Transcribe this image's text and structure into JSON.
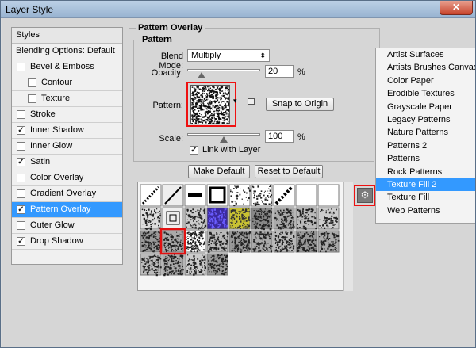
{
  "window": {
    "title": "Layer Style",
    "close_glyph": "✕"
  },
  "styles_panel": {
    "header": "Styles",
    "items": [
      {
        "label": "Blending Options: Default",
        "has_checkbox": false,
        "checked": false,
        "indent": false,
        "selected": false
      },
      {
        "label": "Bevel & Emboss",
        "has_checkbox": true,
        "checked": false,
        "indent": false,
        "selected": false
      },
      {
        "label": "Contour",
        "has_checkbox": true,
        "checked": false,
        "indent": true,
        "selected": false
      },
      {
        "label": "Texture",
        "has_checkbox": true,
        "checked": false,
        "indent": true,
        "selected": false
      },
      {
        "label": "Stroke",
        "has_checkbox": true,
        "checked": false,
        "indent": false,
        "selected": false
      },
      {
        "label": "Inner Shadow",
        "has_checkbox": true,
        "checked": true,
        "indent": false,
        "selected": false
      },
      {
        "label": "Inner Glow",
        "has_checkbox": true,
        "checked": false,
        "indent": false,
        "selected": false
      },
      {
        "label": "Satin",
        "has_checkbox": true,
        "checked": true,
        "indent": false,
        "selected": false
      },
      {
        "label": "Color Overlay",
        "has_checkbox": true,
        "checked": false,
        "indent": false,
        "selected": false
      },
      {
        "label": "Gradient Overlay",
        "has_checkbox": true,
        "checked": false,
        "indent": false,
        "selected": false
      },
      {
        "label": "Pattern Overlay",
        "has_checkbox": true,
        "checked": true,
        "indent": false,
        "selected": true
      },
      {
        "label": "Outer Glow",
        "has_checkbox": true,
        "checked": false,
        "indent": false,
        "selected": false
      },
      {
        "label": "Drop Shadow",
        "has_checkbox": true,
        "checked": true,
        "indent": false,
        "selected": false
      }
    ]
  },
  "pattern_overlay": {
    "group_title": "Pattern Overlay",
    "subgroup_title": "Pattern",
    "blend_mode_label": "Blend Mode:",
    "blend_mode_value": "Multiply",
    "opacity_label": "Opacity:",
    "opacity_value": "20",
    "opacity_fraction": 0.2,
    "percent_unit": "%",
    "pattern_label": "Pattern:",
    "snap_button": "Snap to Origin",
    "scale_label": "Scale:",
    "scale_value": "100",
    "scale_fraction": 0.5,
    "link_label": "Link with Layer",
    "link_checked": true,
    "make_default_button": "Make Default",
    "reset_default_button": "Reset to Default"
  },
  "pattern_picker": {
    "gear_glyph": "⚙",
    "selected_index": 19
  },
  "flyout_menu": {
    "items": [
      {
        "label": "Artist Surfaces",
        "highlighted": false
      },
      {
        "label": "Artists Brushes Canvas",
        "highlighted": false
      },
      {
        "label": "Color Paper",
        "highlighted": false
      },
      {
        "label": "Erodible Textures",
        "highlighted": false
      },
      {
        "label": "Grayscale Paper",
        "highlighted": false
      },
      {
        "label": "Legacy Patterns",
        "highlighted": false
      },
      {
        "label": "Nature Patterns",
        "highlighted": false
      },
      {
        "label": "Patterns 2",
        "highlighted": false
      },
      {
        "label": "Patterns",
        "highlighted": false
      },
      {
        "label": "Rock Patterns",
        "highlighted": false
      },
      {
        "label": "Texture Fill 2",
        "highlighted": true
      },
      {
        "label": "Texture Fill",
        "highlighted": false
      },
      {
        "label": "Web Patterns",
        "highlighted": false
      }
    ]
  },
  "colors": {
    "selection": "#3399ff",
    "highlight_red": "#e11111"
  }
}
